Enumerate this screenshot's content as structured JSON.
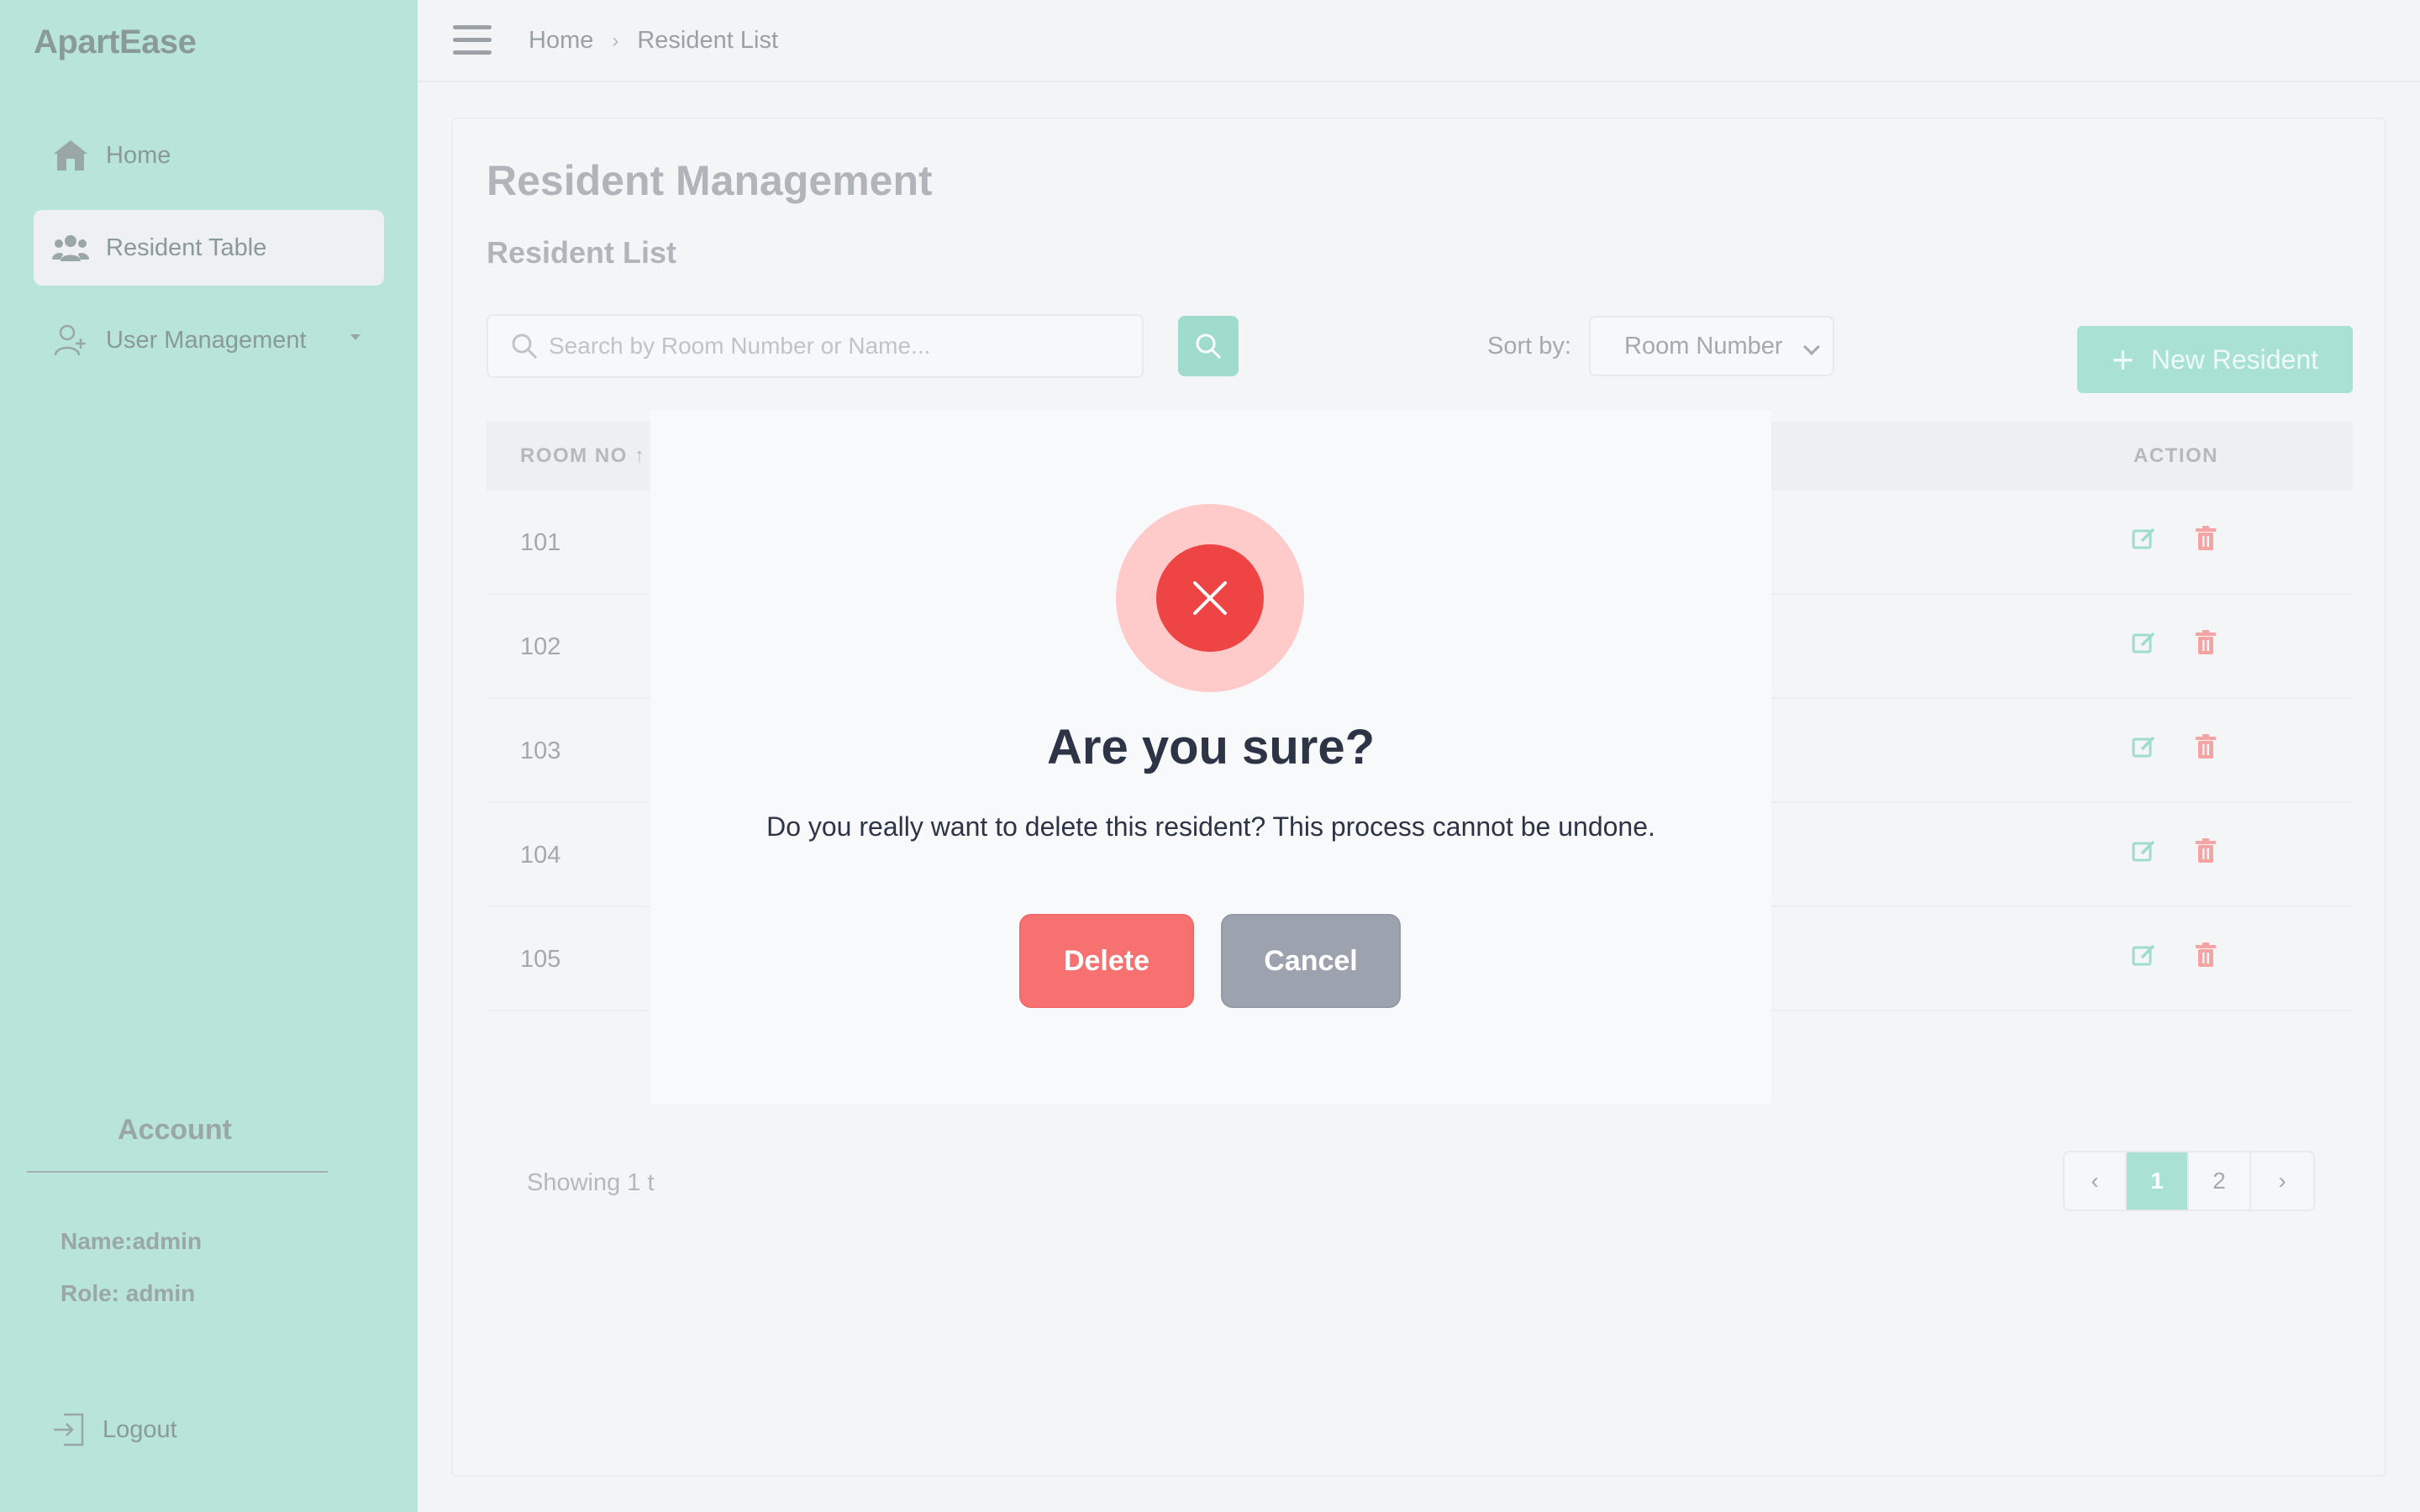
{
  "app": {
    "brand": "ApartEase"
  },
  "sidebar": {
    "items": [
      {
        "label": "Home",
        "icon": "home-icon"
      },
      {
        "label": "Resident Table",
        "icon": "users-icon",
        "active": true
      },
      {
        "label": "User Management",
        "icon": "user-plus-icon",
        "has_submenu": true
      }
    ],
    "account": {
      "title": "Account",
      "name": "Name:admin",
      "role": "Role: admin"
    },
    "logout_label": "Logout"
  },
  "header": {
    "breadcrumb": [
      "Home",
      "Resident List"
    ]
  },
  "main": {
    "title": "Resident Management",
    "subtitle": "Resident List",
    "search": {
      "placeholder": "Search by Room Number or Name...",
      "value": ""
    },
    "sort": {
      "label": "Sort by:",
      "selected": "Room Number"
    },
    "new_button_label": "New Resident",
    "table": {
      "columns": {
        "room": "ROOM NO ↑",
        "action": "ACTION"
      },
      "rows": [
        {
          "room": "101"
        },
        {
          "room": "102"
        },
        {
          "room": "103"
        },
        {
          "room": "104"
        },
        {
          "room": "105"
        }
      ]
    },
    "showing_text": "Showing 1 t",
    "pagination": {
      "pages": [
        "1",
        "2"
      ],
      "current": "1",
      "prev": "‹",
      "next": "›"
    }
  },
  "modal": {
    "title": "Are you sure?",
    "message": "Do you really want to delete this resident? This process cannot be undone.",
    "delete_label": "Delete",
    "cancel_label": "Cancel",
    "icon": "close-icon"
  },
  "colors": {
    "sidebar_bg": "#b8e4da",
    "accent": "#a9e2d4",
    "danger": "#ef4444",
    "danger_light": "#fecaca",
    "delete_button": "#f87171",
    "cancel_button": "#9ca3af"
  }
}
